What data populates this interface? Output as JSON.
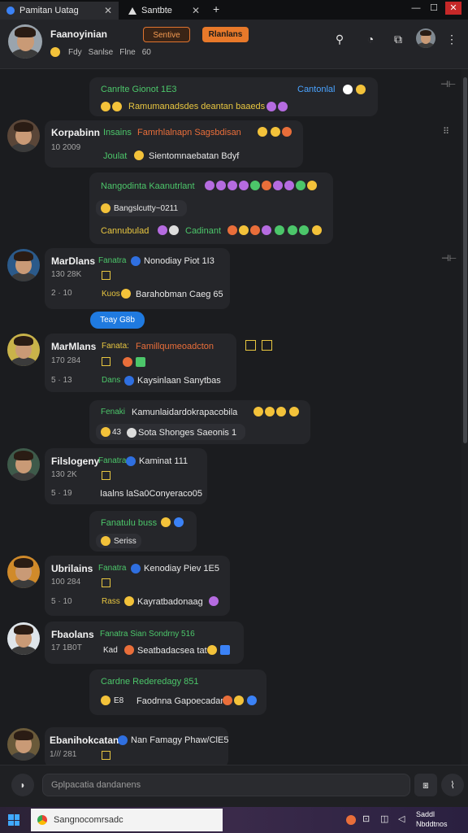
{
  "tabs": [
    {
      "label": "Pamitan Uatag",
      "active": true
    },
    {
      "label": "Santbte",
      "active": false
    }
  ],
  "tab_new": "+",
  "window_controls": [
    "—",
    "☐",
    "✕"
  ],
  "header": {
    "name": "Faanoyinian",
    "subtitle": [
      "Fdy",
      "Sanlse",
      "Flne",
      "60"
    ],
    "pill_outline": "Sentive",
    "pill_solid": "Rlanlans"
  },
  "colors": {
    "accent": "#e8792a",
    "link": "#1f7ae0",
    "green": "#4cc66a",
    "yellow": "#e8c640"
  },
  "messages": {
    "m1": {
      "line1a": "Canrlte Gionot 1E3",
      "line1b": "Cantonlal",
      "line2": "Ramumanadsdes deantan baaeds"
    },
    "m2": {
      "name": "Korpabinn",
      "meta": "10 2009",
      "line1a": "Insains",
      "line1b": "Famrhlalnapn Sagsbdisan",
      "line2a": "Joulat",
      "line2b": "Sientomnaebatan Bdyf"
    },
    "m3": {
      "line1": "Nangodinta Kaanutrlant",
      "line2": "Bangslcutty~0211",
      "line3a": "Cannubulad",
      "line3b": "Cadinant"
    },
    "m4": {
      "name": "MarDlans",
      "meta": "130 28K",
      "react": "2 · 10",
      "line1a": "Fanatra",
      "line1b": "Nonodiay Piot 1I3",
      "line2a": "Kuos",
      "line2b": "Barahobman Caeg 65"
    },
    "jump_label": "Teay G8b",
    "m5": {
      "name": "MarMlans",
      "meta": "170 284",
      "react": "5 · 13",
      "line1a": "Fanata:",
      "line1b": "Famillqumeoadcton",
      "line2a": "Dans",
      "line2b": "Kaysinlaan Sanytbas"
    },
    "m6": {
      "line1a": "Fenaki",
      "line1b": "Kamunlaidardokrapacobila",
      "line2a": "43",
      "line2b": "Sota Shonges Saeonis 1"
    },
    "m7": {
      "name": "Filslogeny",
      "meta": "130 2K",
      "react": "5 · 19",
      "line1a": "Fanatra",
      "line1b": "Kaminat 111",
      "line2": "Iaalns laSa0Conyeraco05"
    },
    "m8": {
      "line1": "Fanatulu buss",
      "line2": "Seriss"
    },
    "m9": {
      "name": "Ubrilains",
      "meta": "100 284",
      "react": "5 · 10",
      "line1a": "Fanatra",
      "line1b": "Kenodiay Piev 1E5",
      "line2a": "Rass",
      "line2b": "Kayratbadonaag"
    },
    "m10": {
      "name": "Fbaolans",
      "meta": "17 1B0T",
      "line1": "Fanatra Sian Sondrny 516",
      "line2a": "Kad",
      "line2b": "Seatbadacsea tat"
    },
    "m11": {
      "line1": "Cardne Rederedagy 851",
      "line2a": "E8",
      "line2b": "Faodnna Gapoecadan"
    },
    "m12": {
      "name": "Ebanihokcatan",
      "line1": "Nan Famagy Phaw/ClE5",
      "meta": "1/// 281"
    }
  },
  "input": {
    "placeholder": "Gplpacatia dandanens"
  },
  "taskbar": {
    "search": "Sangnocomrsadc",
    "time": "Saddl",
    "date": "Nbddtnos"
  }
}
